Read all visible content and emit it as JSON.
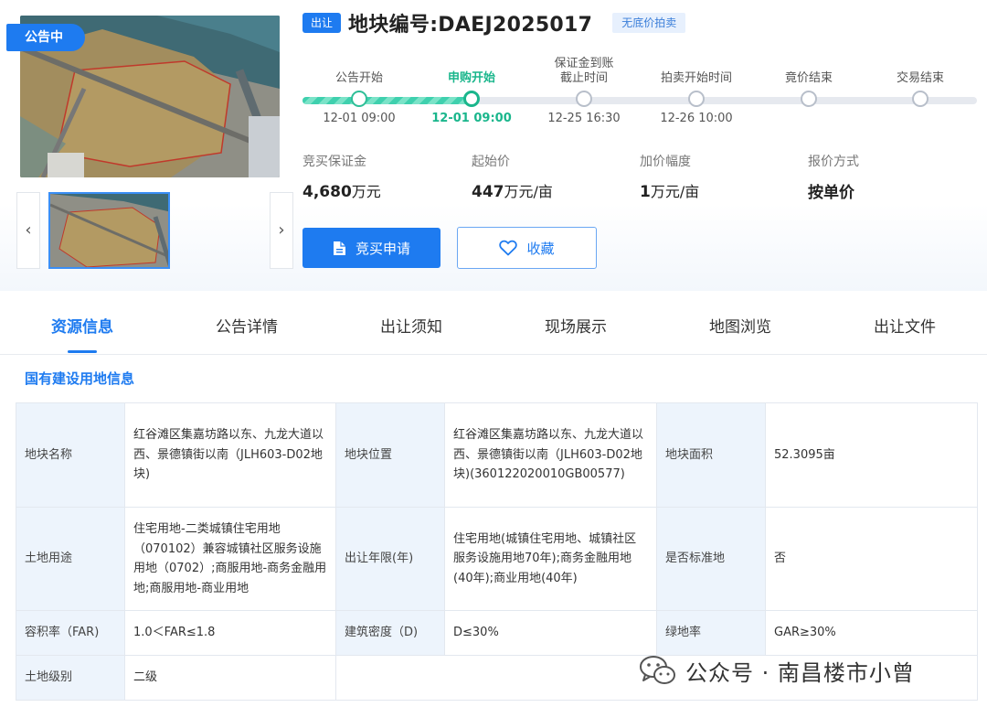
{
  "gallery": {
    "status_tag": "公告中",
    "prev": "‹",
    "next": "›"
  },
  "header": {
    "sale_badge": "出让",
    "title": "地块编号:DAEJ2025017",
    "no_reserve_badge": "无底价拍卖"
  },
  "timeline": [
    {
      "label": "公告开始",
      "time": "12-01 09:00",
      "state": "done"
    },
    {
      "label": "申购开始",
      "time": "12-01 09:00",
      "state": "active"
    },
    {
      "label": "保证金到账截止时间",
      "time": "12-25 16:30",
      "state": "pending"
    },
    {
      "label": "拍卖开始时间",
      "time": "12-26 10:00",
      "state": "pending"
    },
    {
      "label": "竟价结束",
      "time": "",
      "state": "pending"
    },
    {
      "label": "交易结束",
      "time": "",
      "state": "pending"
    }
  ],
  "info": {
    "deposit": {
      "label": "竞买保证金",
      "value": "4,680",
      "unit": "万元"
    },
    "start_price": {
      "label": "起始价",
      "value": "447",
      "unit": "万元/亩"
    },
    "increment": {
      "label": "加价幅度",
      "value": "1",
      "unit": "万元/亩"
    },
    "quote_method": {
      "label": "报价方式",
      "value": "按单价"
    }
  },
  "actions": {
    "apply": "竞买申请",
    "favorite": "收藏"
  },
  "tabs": [
    "资源信息",
    "公告详情",
    "出让须知",
    "现场展示",
    "地图浏览",
    "出让文件"
  ],
  "section_title": "国有建设用地信息",
  "table": {
    "name_k": "地块名称",
    "name_v": "红谷滩区集嘉坊路以东、九龙大道以西、景德镇街以南（JLH603-D02地块)",
    "location_k": "地块位置",
    "location_v": "红谷滩区集嘉坊路以东、九龙大道以西、景德镇街以南（JLH603-D02地块)(360122020010GB00577)",
    "area_k": "地块面积",
    "area_v": "52.3095亩",
    "use_k": "土地用途",
    "use_v": "住宅用地-二类城镇住宅用地（070102）兼容城镇社区服务设施用地（0702）;商服用地-商务金融用地;商服用地-商业用地",
    "term_k": "出让年限(年)",
    "term_v": "住宅用地(城镇住宅用地、城镇社区服务设施用地70年);商务金融用地(40年);商业用地(40年)",
    "standard_k": "是否标准地",
    "standard_v": "否",
    "far_k": "容积率（FAR)",
    "far_v": "1.0＜FAR≤1.8",
    "density_k": "建筑密度（D)",
    "density_v": "D≤30%",
    "green_k": "绿地率",
    "green_v": "GAR≥30%",
    "grade_k": "土地级别",
    "grade_v": "二级"
  },
  "watermark": "公众号 · 南昌楼市小曾",
  "colors": {
    "brand": "#1e7bf0",
    "progress": "#2fbf98",
    "label_bg": "#edf4fc"
  }
}
